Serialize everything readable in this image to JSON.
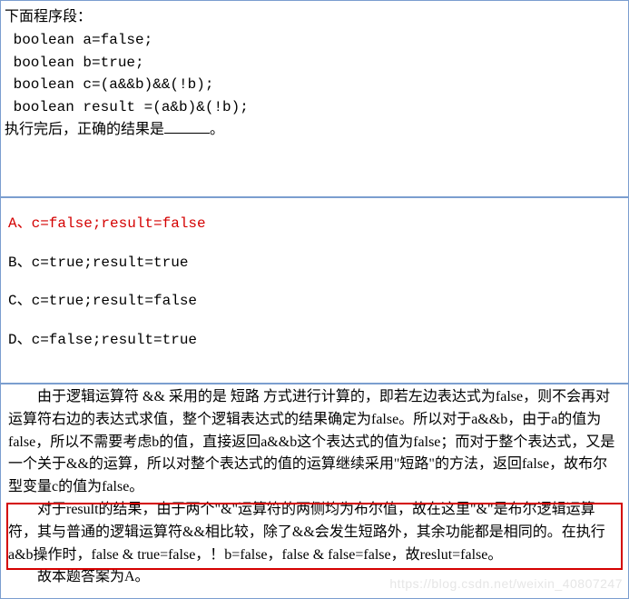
{
  "question": {
    "title_line": "下面程序段：",
    "code_lines": [
      " boolean a=false;",
      " boolean b=true;",
      " boolean c=(a&&b)&&(!b);",
      " boolean result =(a&b)&(!b);"
    ],
    "prompt_line_prefix": "执行完后，正确的结果是",
    "prompt_line_suffix": "。"
  },
  "options": {
    "A": "A、c=false;result=false",
    "B": "B、c=true;result=true",
    "C": "C、c=true;result=false",
    "D": "D、c=false;result=true"
  },
  "explanation": {
    "p1": "由于逻辑运算符 && 采用的是 短路 方式进行计算的，即若左边表达式为false，则不会再对运算符右边的表达式求值，整个逻辑表达式的结果确定为false。所以对于a&&b，由于a的值为false，所以不需要考虑b的值，直接返回a&&b这个表达式的值为false；而对于整个表达式，又是一个关于&&的运算，所以对整个表达式的值的运算继续采用\"短路\"的方法，返回false，故布尔型变量c的值为false。",
    "p2": "对于result的结果，由于两个\"&\"运算符的两侧均为布尔值，故在这里\"&\"是布尔逻辑运算符，其与普通的逻辑运算符&&相比较，除了&&会发生短路外，其余功能都是相同的。在执行a&b操作时，false & true=false，！b=false，false & false=false，故reslut=false。",
    "p3": "故本题答案为A。"
  },
  "watermark": "https://blog.csdn.net/weixin_40807247"
}
